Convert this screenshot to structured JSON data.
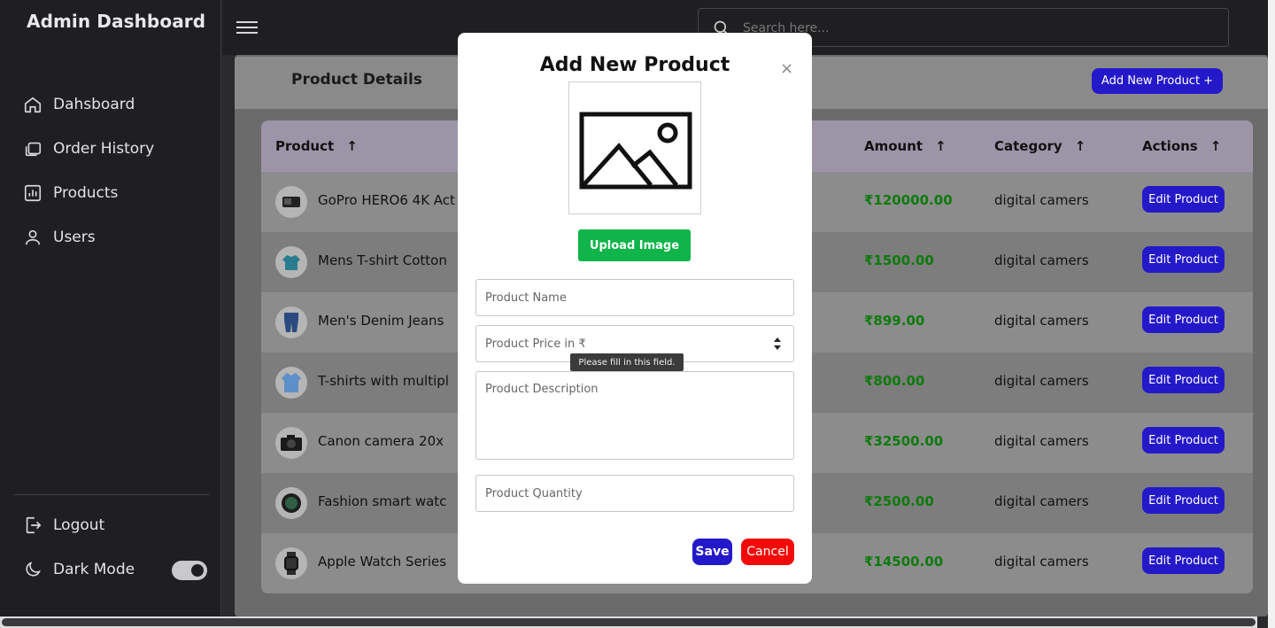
{
  "app": {
    "title": "Admin Dashboard"
  },
  "sidebar": {
    "items": [
      {
        "label": "Dahsboard",
        "icon": "home-icon"
      },
      {
        "label": "Order History",
        "icon": "layers-icon"
      },
      {
        "label": "Products",
        "icon": "bar-chart-icon"
      },
      {
        "label": "Users",
        "icon": "user-icon"
      }
    ],
    "logout": "Logout",
    "dark_mode": "Dark Mode",
    "dark_mode_on": true
  },
  "topbar": {
    "search_placeholder": "Search here..."
  },
  "page": {
    "title": "Product Details",
    "add_button": "Add New Product +"
  },
  "table": {
    "headers": [
      "Product",
      "Amount",
      "Category",
      "Actions"
    ],
    "sort_arrow": "↑",
    "edit_label": "Edit Product",
    "rows": [
      {
        "name": "GoPro HERO6 4K Act",
        "amount": "₹120000.00",
        "category": "digital camers"
      },
      {
        "name": "Mens T-shirt Cotton",
        "amount": "₹1500.00",
        "category": "digital camers"
      },
      {
        "name": "Men's Denim Jeans",
        "amount": "₹899.00",
        "category": "digital camers"
      },
      {
        "name": "T-shirts with multipl",
        "amount": "₹800.00",
        "category": "digital camers"
      },
      {
        "name": "Canon camera 20x",
        "amount": "₹32500.00",
        "category": "digital camers"
      },
      {
        "name": "Fashion smart watc",
        "amount": "₹2500.00",
        "category": "digital camers"
      },
      {
        "name": "Apple Watch Series",
        "amount": "₹14500.00",
        "category": "digital camers"
      }
    ]
  },
  "modal": {
    "title": "Add New Product",
    "close": "×",
    "upload_button": "Upload Image",
    "name_placeholder": "Product Name",
    "price_placeholder": "Product Price in ₹",
    "description_placeholder": "Product Description",
    "quantity_placeholder": "Product Quantity",
    "validation_tooltip": "Please fill in this field.",
    "save": "Save",
    "cancel": "Cancel"
  },
  "colors": {
    "accent": "#2419c9",
    "success": "#0fb44a",
    "danger": "#f20a0a",
    "amount": "#0d7a0d"
  }
}
